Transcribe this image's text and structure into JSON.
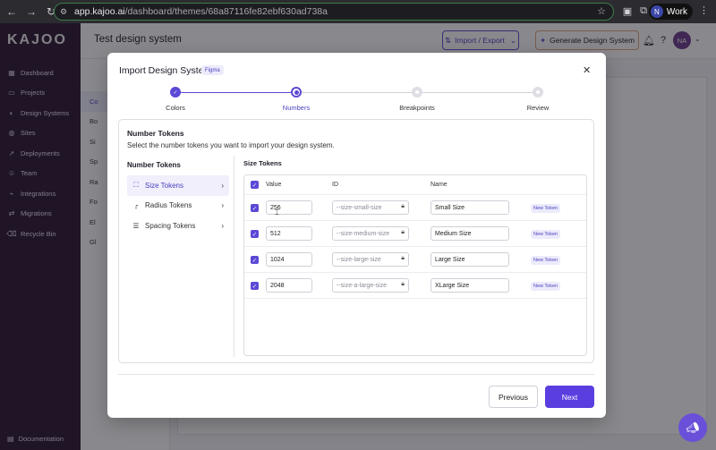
{
  "browser": {
    "url_host": "app.kajoo.ai",
    "url_path": "/dashboard/themes/68a87116fe82ebf630ad738a",
    "profile_initial": "N",
    "profile_label": "Work"
  },
  "app": {
    "logo": "KAJOO",
    "page_title": "Test design system",
    "import_export_label": "Import / Export",
    "generate_label": "Generate Design System",
    "avatar_initials": "NA",
    "nav": [
      {
        "label": "Dashboard",
        "icon": "dashboard-icon"
      },
      {
        "label": "Projects",
        "icon": "folder-icon"
      },
      {
        "label": "Design Systems",
        "icon": "palette-icon"
      },
      {
        "label": "Sites",
        "icon": "globe-icon"
      },
      {
        "label": "Deployments",
        "icon": "rocket-icon"
      },
      {
        "label": "Team",
        "icon": "team-icon"
      },
      {
        "label": "Integrations",
        "icon": "plug-icon"
      },
      {
        "label": "Migrations",
        "icon": "migrate-icon"
      },
      {
        "label": "Recycle Bin",
        "icon": "trash-icon"
      }
    ],
    "docs_label": "Documentation",
    "subnav": [
      "Co",
      "Bo",
      "Si",
      "Sp",
      "Ra",
      "Fo",
      "El",
      "Gl"
    ]
  },
  "modal": {
    "title": "Import Design System",
    "badge": "Figma",
    "steps": [
      {
        "label": "Colors",
        "status": "complete"
      },
      {
        "label": "Numbers",
        "status": "current"
      },
      {
        "label": "Breakpoints",
        "status": "todo"
      },
      {
        "label": "Review",
        "status": "todo"
      }
    ],
    "section_title": "Number Tokens",
    "section_desc": "Select the number tokens you want to import your design system.",
    "categories_title": "Number Tokens",
    "categories": [
      {
        "label": "Size Tokens",
        "icon": "expand-icon",
        "active": true
      },
      {
        "label": "Radius Tokens",
        "icon": "radius-icon",
        "active": false
      },
      {
        "label": "Spacing Tokens",
        "icon": "spacing-icon",
        "active": false
      }
    ],
    "table_title": "Size Tokens",
    "columns": {
      "value": "Value",
      "id": "ID",
      "name": "Name"
    },
    "rows": [
      {
        "value": "256",
        "id": "--size-small-size",
        "name": "Small Size",
        "tag": "New Token"
      },
      {
        "value": "512",
        "id": "--size-medium-size",
        "name": "Medium Size",
        "tag": "New Token"
      },
      {
        "value": "1024",
        "id": "--size-large-size",
        "name": "Large Size",
        "tag": "New Token"
      },
      {
        "value": "2048",
        "id": "--size-a-large-size",
        "name": "XLarge Size",
        "tag": "New Token"
      }
    ],
    "previous_label": "Previous",
    "next_label": "Next"
  },
  "colors": {
    "accent": "#5b49d6",
    "sidebar": "#2c1733",
    "next_button": "#5b3ee0"
  }
}
